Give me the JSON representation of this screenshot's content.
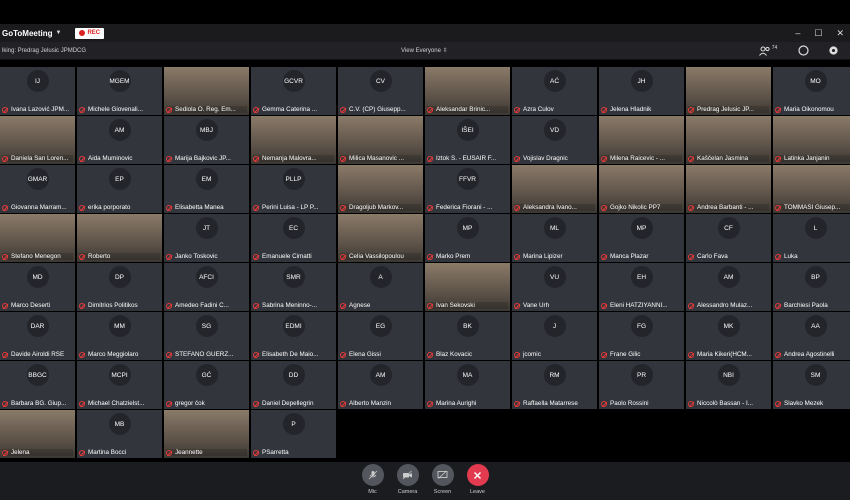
{
  "app": {
    "name": "GoToMeeting",
    "rec_label": "REC"
  },
  "toolbar": {
    "talking": "lking: Predrag Jelusic JPMDCG",
    "view": "View Everyone",
    "attendee_count": "74"
  },
  "participants": [
    {
      "initials": "IJ",
      "name": "Ivana Lazović JPM..."
    },
    {
      "initials": "MGEM",
      "name": "Michele Giovenali..."
    },
    {
      "initials": "",
      "name": "Sediola O. Reg. Em...",
      "video": true
    },
    {
      "initials": "GCVR",
      "name": "Gemma Caterina ..."
    },
    {
      "initials": "CV",
      "name": "C.V. (CP) Giusepp..."
    },
    {
      "initials": "",
      "name": "Aleksandar Brinic...",
      "video": true
    },
    {
      "initials": "AĆ",
      "name": "Azra Ćulov"
    },
    {
      "initials": "JH",
      "name": "Jelena Hladnik"
    },
    {
      "initials": "",
      "name": "Predrag Jelusic JP...",
      "video": true
    },
    {
      "initials": "MO",
      "name": "Maria Oikonomou"
    },
    {
      "initials": "",
      "name": "Daniela San Loren...",
      "video": true
    },
    {
      "initials": "AM",
      "name": "Aida Muminovic"
    },
    {
      "initials": "MBJ",
      "name": "Marija Bajkovic JP..."
    },
    {
      "initials": "",
      "name": "Nemanja Malovra...",
      "video": true
    },
    {
      "initials": "",
      "name": "Milica Masanovic ...",
      "video": true
    },
    {
      "initials": "IŠEI",
      "name": "Iztok Š. - EUSAIR F..."
    },
    {
      "initials": "VD",
      "name": "Vojislav Dragnic"
    },
    {
      "initials": "",
      "name": "Milena Raicevic - ...",
      "video": true
    },
    {
      "initials": "",
      "name": "Kaščelan Jasmina",
      "video": true
    },
    {
      "initials": "",
      "name": "Latinka Janjanin",
      "video": true
    },
    {
      "initials": "GMAR",
      "name": "Giovanna Marram..."
    },
    {
      "initials": "EP",
      "name": "erika porporato"
    },
    {
      "initials": "EM",
      "name": "Elisabetta Manea"
    },
    {
      "initials": "PLLP",
      "name": "Perini Luisa - LP P..."
    },
    {
      "initials": "",
      "name": "Dragoljub Markov...",
      "video": true
    },
    {
      "initials": "FFVR",
      "name": "Federica Fiorani - ..."
    },
    {
      "initials": "",
      "name": "Aleksandra Ivano...",
      "video": true
    },
    {
      "initials": "",
      "name": "Gojko Nikolic PP7",
      "video": true
    },
    {
      "initials": "",
      "name": "Andrea Barbanti - ...",
      "video": true
    },
    {
      "initials": "",
      "name": "TOMMASI Giusep...",
      "video": true
    },
    {
      "initials": "",
      "name": "Stefano Menegon",
      "video": true
    },
    {
      "initials": "",
      "name": "Roberto",
      "video": true
    },
    {
      "initials": "JT",
      "name": "Janko Toskovic"
    },
    {
      "initials": "EC",
      "name": "Emanuele Cimatti"
    },
    {
      "initials": "",
      "name": "Celia Vassilopoulou",
      "video": true
    },
    {
      "initials": "MP",
      "name": "Marko Prem"
    },
    {
      "initials": "ML",
      "name": "Marina Lipizer"
    },
    {
      "initials": "MP",
      "name": "Manca Plazar"
    },
    {
      "initials": "CF",
      "name": "Carlo Fava"
    },
    {
      "initials": "L",
      "name": "Luka"
    },
    {
      "initials": "MD",
      "name": "Marco Deserti"
    },
    {
      "initials": "DP",
      "name": "Dimitrios Politikos"
    },
    {
      "initials": "AFCI",
      "name": "Amedeo Fadini C..."
    },
    {
      "initials": "SMR",
      "name": "Sabrina Meninno-..."
    },
    {
      "initials": "A",
      "name": "Agnese"
    },
    {
      "initials": "",
      "name": "Ivan Sekovski",
      "video": true
    },
    {
      "initials": "VU",
      "name": "Vane Urh"
    },
    {
      "initials": "EH",
      "name": "Eleni HATZIYANNI..."
    },
    {
      "initials": "AM",
      "name": "Alessandro Mulaz..."
    },
    {
      "initials": "BP",
      "name": "Barchiesi Paola"
    },
    {
      "initials": "DAR",
      "name": "Davide Airoldi RSE"
    },
    {
      "initials": "MM",
      "name": "Marco Meggiolaro"
    },
    {
      "initials": "SG",
      "name": "STEFANO GUERZ..."
    },
    {
      "initials": "EDMI",
      "name": "Elisabeth De Maio..."
    },
    {
      "initials": "EG",
      "name": "Elena Gissi"
    },
    {
      "initials": "BK",
      "name": "Blaz Kovacic"
    },
    {
      "initials": "J",
      "name": "jcomic"
    },
    {
      "initials": "FG",
      "name": "Frane Gilic"
    },
    {
      "initials": "MK",
      "name": "Maria Kikeri(HCM..."
    },
    {
      "initials": "AA",
      "name": "Andrea Agostinelli"
    },
    {
      "initials": "BBGC",
      "name": "Barbara BG. Giup..."
    },
    {
      "initials": "MCPI",
      "name": "Michael Chatzielst..."
    },
    {
      "initials": "GĆ",
      "name": "gregor čok"
    },
    {
      "initials": "DD",
      "name": "Daniel Depellegrin"
    },
    {
      "initials": "AM",
      "name": "Alberto Manzin"
    },
    {
      "initials": "MA",
      "name": "Marina Aurighi"
    },
    {
      "initials": "RM",
      "name": "Raffaella Matarrese"
    },
    {
      "initials": "PR",
      "name": "Paolo Rossini"
    },
    {
      "initials": "NBI",
      "name": "Niccolò Bassan - I..."
    },
    {
      "initials": "SM",
      "name": "Slavko Mezek"
    },
    {
      "initials": "",
      "name": "Jelena",
      "video": true
    },
    {
      "initials": "MB",
      "name": "Martina Bocci"
    },
    {
      "initials": "",
      "name": "Jeannette",
      "video": true
    },
    {
      "initials": "P",
      "name": "PSarretta"
    }
  ],
  "controls": [
    {
      "name": "mic",
      "label": "Mic"
    },
    {
      "name": "camera",
      "label": "Camera"
    },
    {
      "name": "screen",
      "label": "Screen"
    },
    {
      "name": "leave",
      "label": "Leave"
    }
  ],
  "colors": {
    "accent_red": "#e23a4e",
    "tile_bg": "#33353c"
  }
}
